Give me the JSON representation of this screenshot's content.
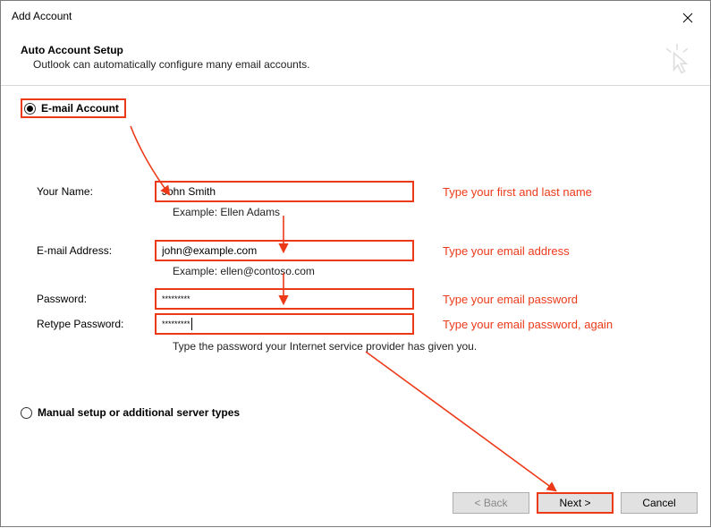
{
  "window": {
    "title": "Add Account"
  },
  "header": {
    "title": "Auto Account Setup",
    "subtitle": "Outlook can automatically configure many email accounts."
  },
  "radios": {
    "email_account": "E-mail Account",
    "manual": "Manual setup or additional server types"
  },
  "form": {
    "name_label": "Your Name:",
    "name_value": "John Smith",
    "name_example": "Example: Ellen Adams",
    "email_label": "E-mail Address:",
    "email_value": "john@example.com",
    "email_example": "Example: ellen@contoso.com",
    "password_label": "Password:",
    "password_value": "*********",
    "retype_label": "Retype Password:",
    "retype_value": "*********",
    "provider_hint": "Type the password your Internet service provider has given you."
  },
  "annotations": {
    "name": "Type your first and last name",
    "email": "Type your email address",
    "password": "Type your email password",
    "retype": "Type your email password, again"
  },
  "buttons": {
    "back": "< Back",
    "next": "Next >",
    "cancel": "Cancel"
  },
  "colors": {
    "highlight": "#ec3a19"
  }
}
